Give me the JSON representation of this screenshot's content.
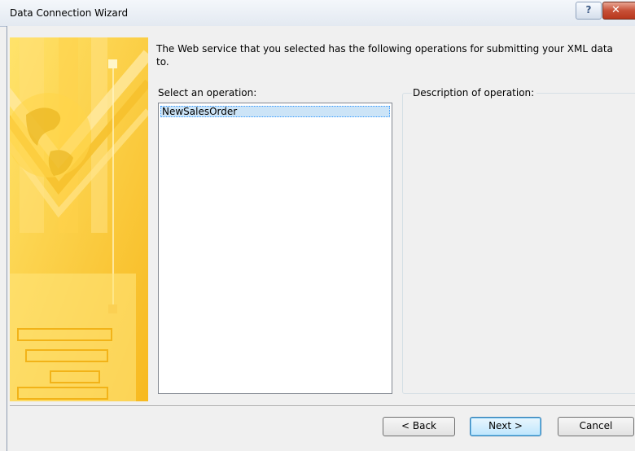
{
  "window": {
    "title": "Data Connection Wizard",
    "help_label": "?",
    "close_label": "✕"
  },
  "intro_text": "The Web service that you selected has the following operations for submitting your XML data to.",
  "operations": {
    "label": "Select an operation:",
    "items": [
      "NewSalesOrder"
    ],
    "selected": "NewSalesOrder"
  },
  "description": {
    "label": "Description of operation:",
    "text": ""
  },
  "buttons": {
    "back": "< Back",
    "next": "Next >",
    "cancel": "Cancel"
  },
  "colors": {
    "side_image_yellow": "#ffc928",
    "selection_bg": "#cce4f7",
    "selection_border": "#3399ff"
  }
}
